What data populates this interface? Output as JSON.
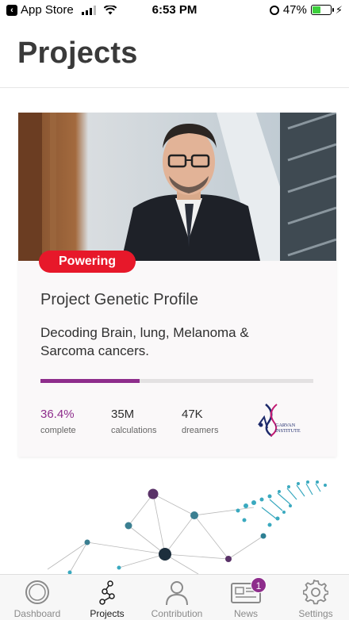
{
  "status_bar": {
    "carrier": "App Store",
    "time": "6:53 PM",
    "battery": "47%"
  },
  "header": {
    "title": "Projects"
  },
  "project_card": {
    "badge": "Powering",
    "title": "Project Genetic Profile",
    "description": "Decoding Brain, lung, Melanoma & Sarcoma cancers.",
    "progress_fraction": 0.364,
    "stats": [
      {
        "value": "36.4%",
        "label": "complete"
      },
      {
        "value": "35M",
        "label": "calculations"
      },
      {
        "value": "47K",
        "label": "dreamers"
      }
    ],
    "partner_logo": {
      "text": "GARVAN INSTITUTE",
      "icon": "garvan-institute-logo"
    }
  },
  "tab_bar": {
    "tabs": [
      {
        "label": "Dashboard",
        "icon": "circle-dashboard-icon",
        "active": false
      },
      {
        "label": "Projects",
        "icon": "network-nodes-icon",
        "active": true
      },
      {
        "label": "Contribution",
        "icon": "person-icon",
        "active": false
      },
      {
        "label": "News",
        "icon": "newspaper-icon",
        "active": false,
        "badge": "1"
      },
      {
        "label": "Settings",
        "icon": "gear-icon",
        "active": false
      }
    ]
  },
  "colors": {
    "accent": "#8e2d8c",
    "badge_red": "#e7182a",
    "network_teal": "#3aa9bf"
  }
}
